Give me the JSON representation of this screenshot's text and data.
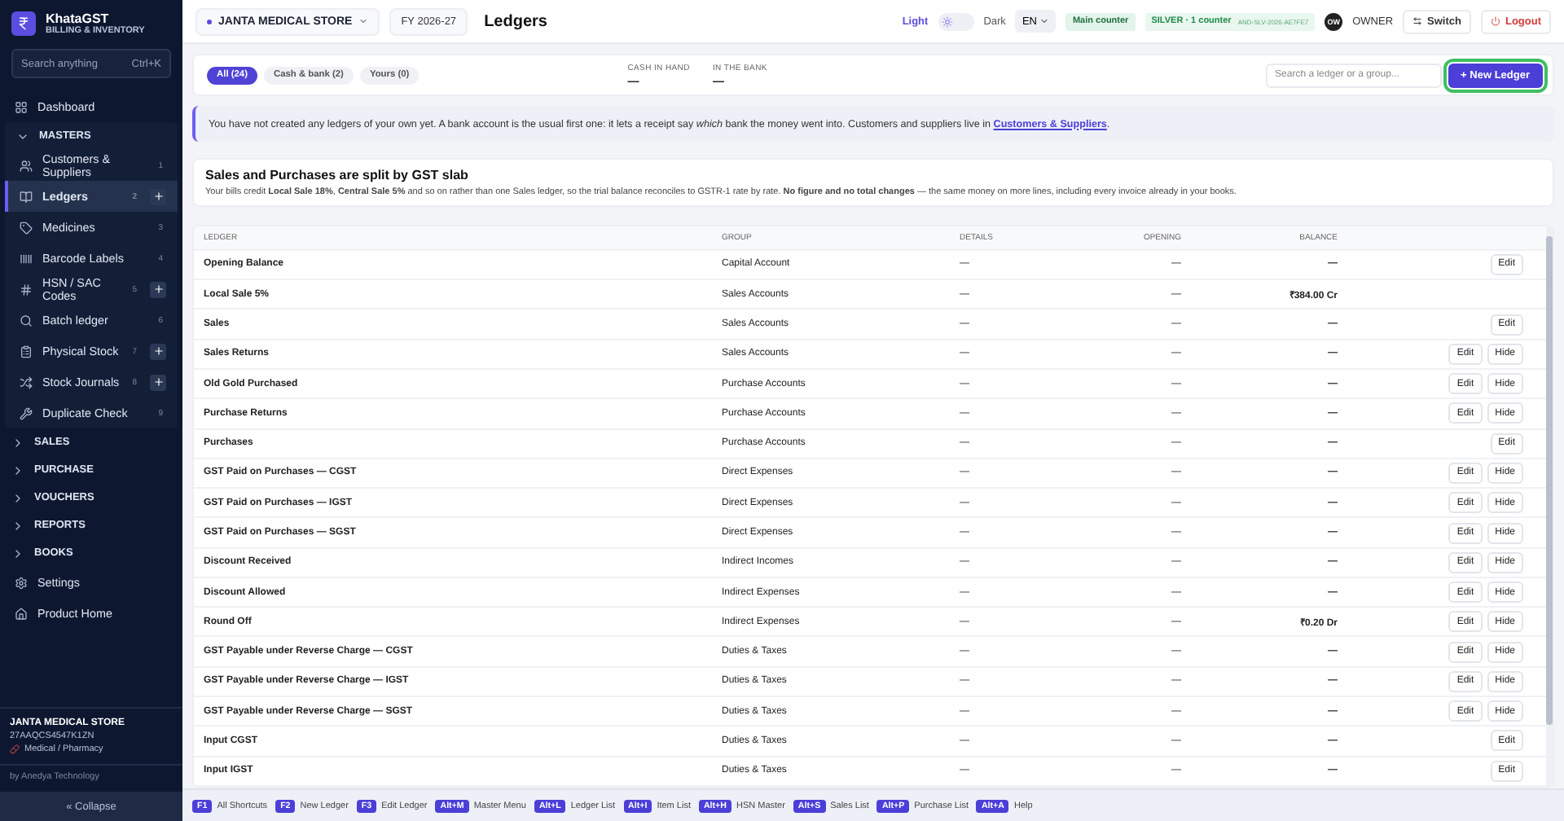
{
  "app": {
    "name": "KhataGST",
    "subtitle": "BILLING & INVENTORY"
  },
  "search": {
    "placeholder": "Search anything",
    "shortcut": "Ctrl+K"
  },
  "nav": [
    {
      "kind": "item",
      "label": "Dashboard",
      "selected": false
    },
    {
      "kind": "section",
      "label": "MASTERS",
      "expanded": true,
      "children": [
        {
          "label": "Customers & Suppliers",
          "key": "1",
          "add": false,
          "selected": false
        },
        {
          "label": "Ledgers",
          "key": "2",
          "add": true,
          "selected": true
        },
        {
          "label": "Medicines",
          "key": "3",
          "add": false,
          "selected": false
        },
        {
          "label": "Barcode Labels",
          "key": "4",
          "add": false,
          "selected": false
        },
        {
          "label": "HSN / SAC Codes",
          "key": "5",
          "add": true,
          "selected": false
        },
        {
          "label": "Batch ledger",
          "key": "6",
          "add": false,
          "selected": false
        },
        {
          "label": "Physical Stock",
          "key": "7",
          "add": true,
          "selected": false
        },
        {
          "label": "Stock Journals",
          "key": "8",
          "add": true,
          "selected": false
        },
        {
          "label": "Duplicate Check",
          "key": "9",
          "add": false,
          "selected": false
        }
      ]
    },
    {
      "kind": "section",
      "label": "SALES",
      "expanded": false
    },
    {
      "kind": "section",
      "label": "PURCHASE",
      "expanded": false
    },
    {
      "kind": "section",
      "label": "VOUCHERS",
      "expanded": false
    },
    {
      "kind": "section",
      "label": "REPORTS",
      "expanded": false
    },
    {
      "kind": "section",
      "label": "BOOKS",
      "expanded": false
    },
    {
      "kind": "item",
      "label": "Settings",
      "selected": false
    },
    {
      "kind": "item",
      "label": "Product Home",
      "selected": false
    }
  ],
  "business": {
    "name": "JANTA MEDICAL STORE",
    "gstin": "27AAQCS4547K1ZN",
    "type": "Medical / Pharmacy",
    "by": "by Anedya Technology"
  },
  "collapse": "« Collapse",
  "topbar": {
    "store": "JANTA MEDICAL STORE",
    "fy": "FY 2026-27",
    "title": "Ledgers",
    "light": "Light",
    "dark": "Dark",
    "dark_mode": false,
    "lang": "EN",
    "counter": "Main counter",
    "plan": "SILVER · 1 counter",
    "license": "AND-SLV-2026-AE7FE7",
    "avatar": "OW",
    "role": "OWNER",
    "switch": "Switch",
    "logout": "Logout"
  },
  "filters": [
    {
      "label": "All (24)",
      "selected": true
    },
    {
      "label": "Cash & bank (2)",
      "selected": false
    },
    {
      "label": "Yours (0)",
      "selected": false
    }
  ],
  "summary": [
    {
      "label": "CASH IN HAND",
      "value": "—"
    },
    {
      "label": "IN THE BANK",
      "value": "—"
    }
  ],
  "ledger_search": {
    "placeholder": "Search a ledger or a group..."
  },
  "new_button": "+ New Ledger",
  "banner": {
    "text": "You have not created any ledgers of your own yet. A bank account is the usual first one: it lets a receipt say *which* bank the money went into. Customers and suppliers live in ",
    "link": "Customers & Suppliers",
    "end": "."
  },
  "notice": {
    "title": "Sales and Purchases are split by GST slab",
    "body": "Your bills credit **Local Sale 18%**, **Central Sale 5%** and so on rather than one Sales ledger, so the trial balance reconciles to GSTR-1 rate by rate. **No figure and no total changes** — the same money on more lines, including every invoice already in your books."
  },
  "table": {
    "columns": [
      "LEDGER",
      "GROUP",
      "DETAILS",
      "OPENING",
      "BALANCE"
    ],
    "rows": [
      {
        "ledger": "Opening Balance",
        "group": "Capital Account",
        "details": "—",
        "opening": "—",
        "balance": "—",
        "actions": [
          "Edit"
        ]
      },
      {
        "ledger": "Local Sale 5%",
        "group": "Sales Accounts",
        "details": "—",
        "opening": "—",
        "balance": "₹384.00 Cr",
        "actions": []
      },
      {
        "ledger": "Sales",
        "group": "Sales Accounts",
        "details": "—",
        "opening": "—",
        "balance": "—",
        "actions": [
          "Edit"
        ]
      },
      {
        "ledger": "Sales Returns",
        "group": "Sales Accounts",
        "details": "—",
        "opening": "—",
        "balance": "—",
        "actions": [
          "Edit",
          "Hide"
        ]
      },
      {
        "ledger": "Old Gold Purchased",
        "group": "Purchase Accounts",
        "details": "—",
        "opening": "—",
        "balance": "—",
        "actions": [
          "Edit",
          "Hide"
        ]
      },
      {
        "ledger": "Purchase Returns",
        "group": "Purchase Accounts",
        "details": "—",
        "opening": "—",
        "balance": "—",
        "actions": [
          "Edit",
          "Hide"
        ]
      },
      {
        "ledger": "Purchases",
        "group": "Purchase Accounts",
        "details": "—",
        "opening": "—",
        "balance": "—",
        "actions": [
          "Edit"
        ]
      },
      {
        "ledger": "GST Paid on Purchases — CGST",
        "group": "Direct Expenses",
        "details": "—",
        "opening": "—",
        "balance": "—",
        "actions": [
          "Edit",
          "Hide"
        ]
      },
      {
        "ledger": "GST Paid on Purchases — IGST",
        "group": "Direct Expenses",
        "details": "—",
        "opening": "—",
        "balance": "—",
        "actions": [
          "Edit",
          "Hide"
        ]
      },
      {
        "ledger": "GST Paid on Purchases — SGST",
        "group": "Direct Expenses",
        "details": "—",
        "opening": "—",
        "balance": "—",
        "actions": [
          "Edit",
          "Hide"
        ]
      },
      {
        "ledger": "Discount Received",
        "group": "Indirect Incomes",
        "details": "—",
        "opening": "—",
        "balance": "—",
        "actions": [
          "Edit",
          "Hide"
        ]
      },
      {
        "ledger": "Discount Allowed",
        "group": "Indirect Expenses",
        "details": "—",
        "opening": "—",
        "balance": "—",
        "actions": [
          "Edit",
          "Hide"
        ]
      },
      {
        "ledger": "Round Off",
        "group": "Indirect Expenses",
        "details": "—",
        "opening": "—",
        "balance": "₹0.20 Dr",
        "actions": [
          "Edit",
          "Hide"
        ]
      },
      {
        "ledger": "GST Payable under Reverse Charge — CGST",
        "group": "Duties & Taxes",
        "details": "—",
        "opening": "—",
        "balance": "—",
        "actions": [
          "Edit",
          "Hide"
        ]
      },
      {
        "ledger": "GST Payable under Reverse Charge — IGST",
        "group": "Duties & Taxes",
        "details": "—",
        "opening": "—",
        "balance": "—",
        "actions": [
          "Edit",
          "Hide"
        ]
      },
      {
        "ledger": "GST Payable under Reverse Charge — SGST",
        "group": "Duties & Taxes",
        "details": "—",
        "opening": "—",
        "balance": "—",
        "actions": [
          "Edit",
          "Hide"
        ]
      },
      {
        "ledger": "Input CGST",
        "group": "Duties & Taxes",
        "details": "—",
        "opening": "—",
        "balance": "—",
        "actions": [
          "Edit"
        ]
      },
      {
        "ledger": "Input IGST",
        "group": "Duties & Taxes",
        "details": "—",
        "opening": "—",
        "balance": "—",
        "actions": [
          "Edit"
        ]
      }
    ]
  },
  "shortcuts": [
    {
      "key": "F1",
      "label": "All Shortcuts"
    },
    {
      "key": "F2",
      "label": "New Ledger"
    },
    {
      "key": "F3",
      "label": "Edit Ledger"
    },
    {
      "key": "Alt+M",
      "label": "Master Menu"
    },
    {
      "key": "Alt+L",
      "label": "Ledger List"
    },
    {
      "key": "Alt+I",
      "label": "Item List"
    },
    {
      "key": "Alt+H",
      "label": "HSN Master"
    },
    {
      "key": "Alt+S",
      "label": "Sales List"
    },
    {
      "key": "Alt+P",
      "label": "Purchase List"
    },
    {
      "key": "Alt+A",
      "label": "Help"
    }
  ]
}
